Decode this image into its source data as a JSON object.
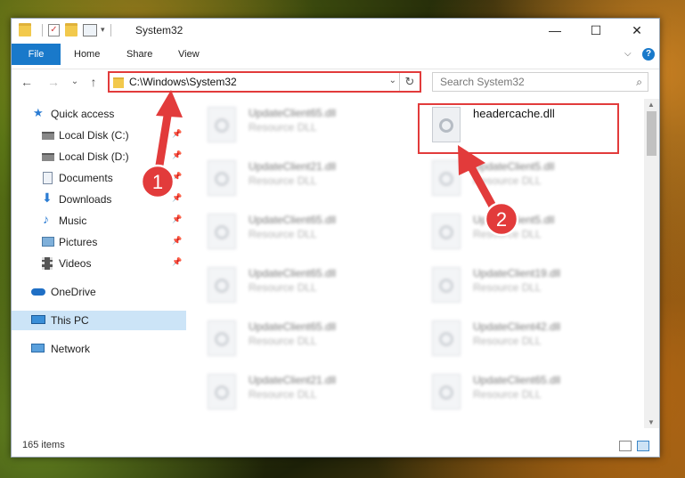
{
  "window": {
    "title": "System32",
    "minimize": "—",
    "maximize": "☐",
    "close": "✕"
  },
  "ribbon": {
    "file": "File",
    "tabs": [
      "Home",
      "Share",
      "View"
    ],
    "collapse": "⌵",
    "help": "?"
  },
  "nav": {
    "back": "←",
    "forward": "→",
    "recent": "⌄",
    "up": "↑",
    "address": "C:\\Windows\\System32",
    "address_dropdown": "⌄",
    "refresh": "↻",
    "search_placeholder": "Search System32",
    "search_icon": "⌕"
  },
  "sidebar": {
    "items": [
      {
        "label": "Quick access",
        "icon": "star-icon",
        "pinned": false
      },
      {
        "label": "Local Disk (C:)",
        "icon": "drive-icon",
        "pinned": true
      },
      {
        "label": "Local Disk (D:)",
        "icon": "drive-icon",
        "pinned": true
      },
      {
        "label": "Documents",
        "icon": "documents-icon",
        "pinned": true
      },
      {
        "label": "Downloads",
        "icon": "download-icon",
        "pinned": true
      },
      {
        "label": "Music",
        "icon": "music-icon",
        "pinned": true
      },
      {
        "label": "Pictures",
        "icon": "pictures-icon",
        "pinned": true
      },
      {
        "label": "Videos",
        "icon": "videos-icon",
        "pinned": true
      },
      {
        "label": "OneDrive",
        "icon": "cloud-icon",
        "pinned": false
      },
      {
        "label": "This PC",
        "icon": "pc-icon",
        "pinned": false
      },
      {
        "label": "Network",
        "icon": "network-icon",
        "pinned": false
      }
    ],
    "pin_glyph": "📌"
  },
  "files": {
    "left_column": [
      {
        "name": "UpdateClient65.dll",
        "type": "Resource DLL"
      },
      {
        "name": "UpdateClient21.dll",
        "type": "Resource DLL"
      },
      {
        "name": "UpdateClient65.dll",
        "type": "Resource DLL"
      },
      {
        "name": "UpdateClient65.dll",
        "type": "Resource DLL"
      },
      {
        "name": "UpdateClient65.dll",
        "type": "Resource DLL"
      },
      {
        "name": "UpdateClient21.dll",
        "type": "Resource DLL"
      }
    ],
    "right_column": [
      {
        "name": "headercache.dll",
        "type": ""
      },
      {
        "name": "UpdateClient5.dll",
        "type": "Resource DLL"
      },
      {
        "name": "UpdateClient5.dll",
        "type": "Resource DLL"
      },
      {
        "name": "UpdateClient19.dll",
        "type": "Resource DLL"
      },
      {
        "name": "UpdateClient42.dll",
        "type": "Resource DLL"
      },
      {
        "name": "UpdateClient65.dll",
        "type": "Resource DLL"
      }
    ]
  },
  "status": {
    "item_count": "165 items"
  },
  "annotations": {
    "step1": "1",
    "step2": "2",
    "color": "#e23b3b"
  }
}
